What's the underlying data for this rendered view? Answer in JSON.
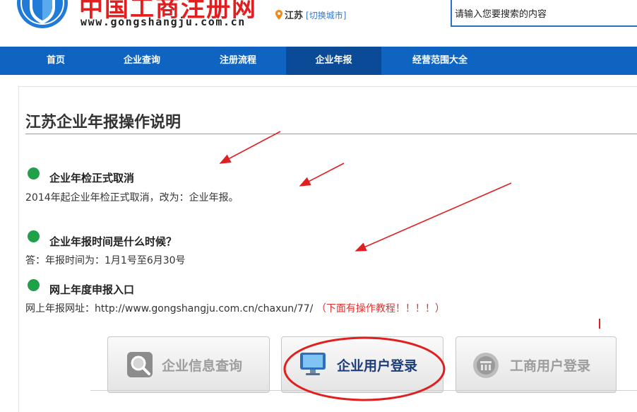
{
  "header": {
    "logo_text": "中国工商注册网",
    "logo_url": "www.gongshangju.com.cn",
    "city_name": "江苏",
    "city_switch": "[切换城市]",
    "search_placeholder": "请输入您要搜索的内容"
  },
  "nav": {
    "items": [
      {
        "label": "首页"
      },
      {
        "label": "企业查询"
      },
      {
        "label": "注册流程"
      },
      {
        "label": "企业年报",
        "active": true
      },
      {
        "label": "经营范围大全"
      }
    ]
  },
  "content": {
    "title": "江苏企业年报操作说明",
    "sections": [
      {
        "title": "企业年检正式取消",
        "body": "2014年起企业年检正式取消，改为：企业年报。"
      },
      {
        "title": "企业年报时间是什么时候？",
        "body": "答：年报时间为：1月1号至6月30号"
      },
      {
        "title": "网上年度申报入口",
        "body": "网上年报网址：http://www.gongshangju.com.cn/chaxun/77/",
        "note": "（下面有操作教程！！！！）"
      }
    ]
  },
  "buttons": [
    {
      "label": "企业信息查询",
      "icon": "magnifier-icon"
    },
    {
      "label": "企业用户登录",
      "icon": "monitor-icon"
    },
    {
      "label": "工商用户登录",
      "icon": "emblem-icon"
    }
  ],
  "colors": {
    "nav_bg": "#0f64c1",
    "nav_active": "#0a4a97",
    "accent_red": "#e02020",
    "bullet_green": "#1fa14a"
  }
}
